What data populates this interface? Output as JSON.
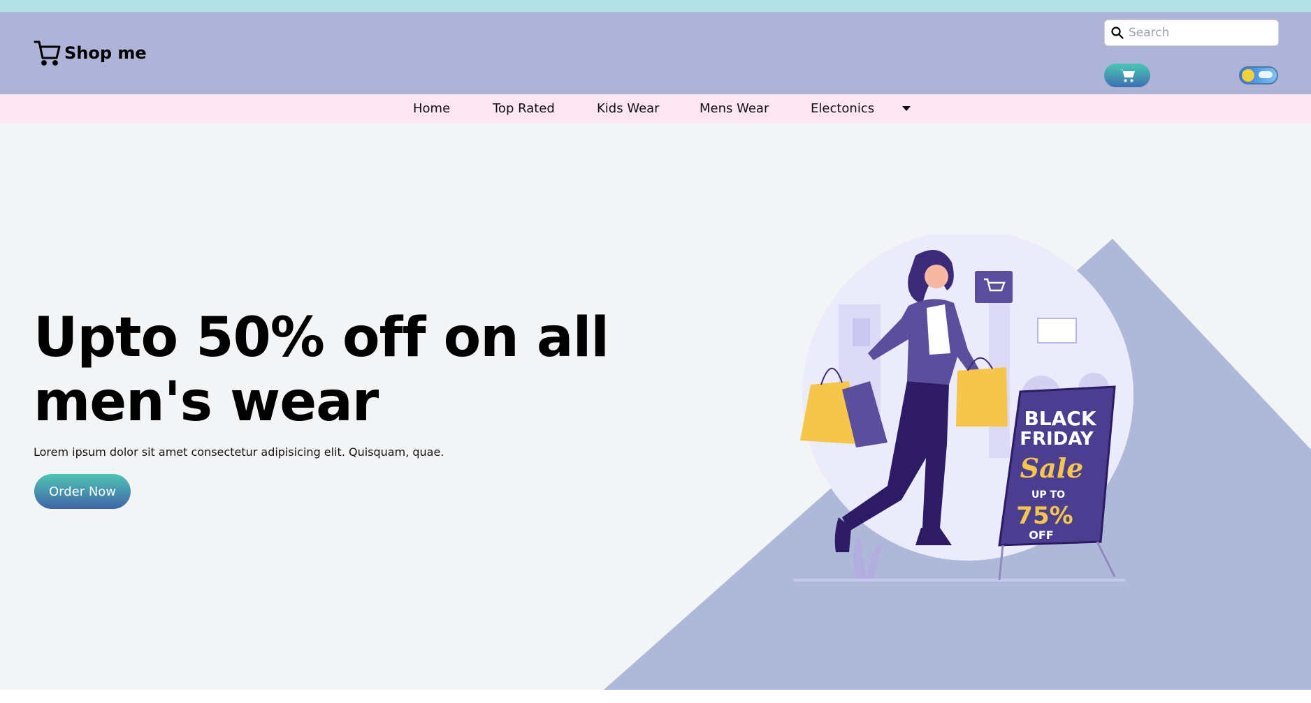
{
  "brand": {
    "name": "Shop me"
  },
  "search": {
    "placeholder": "Search"
  },
  "nav": {
    "items": [
      {
        "label": "Home"
      },
      {
        "label": "Top Rated"
      },
      {
        "label": "Kids Wear"
      },
      {
        "label": "Mens Wear"
      },
      {
        "label": "Electonics"
      }
    ]
  },
  "hero": {
    "headline_line1": "Upto 50% off on all",
    "headline_line2": "men's wear",
    "subtext": "Lorem ipsum dolor sit amet consectetur adipisicing elit. Quisquam, quae.",
    "cta_label": "Order Now"
  },
  "illustration": {
    "sign_line1": "BLACK",
    "sign_line2": "FRIDAY",
    "sign_line3": "Sale",
    "sign_line4": "UP TO",
    "sign_line5": "75%",
    "sign_line6": "OFF"
  },
  "colors": {
    "topstrip": "#b3e1e4",
    "header": "#aeb3d7",
    "navbar": "#fde5f1",
    "hero_bg": "#f3f4f6",
    "hero_triangle": "#aeb9d9",
    "button_gradient_top": "#4fc5b4",
    "button_gradient_bottom": "#3f64a8"
  },
  "icons": {
    "logo": "shopping-cart-icon",
    "search": "search-icon",
    "cart_button": "cart-icon",
    "theme_toggle": "sun-cloud-toggle-icon",
    "nav_more": "caret-down-icon"
  }
}
